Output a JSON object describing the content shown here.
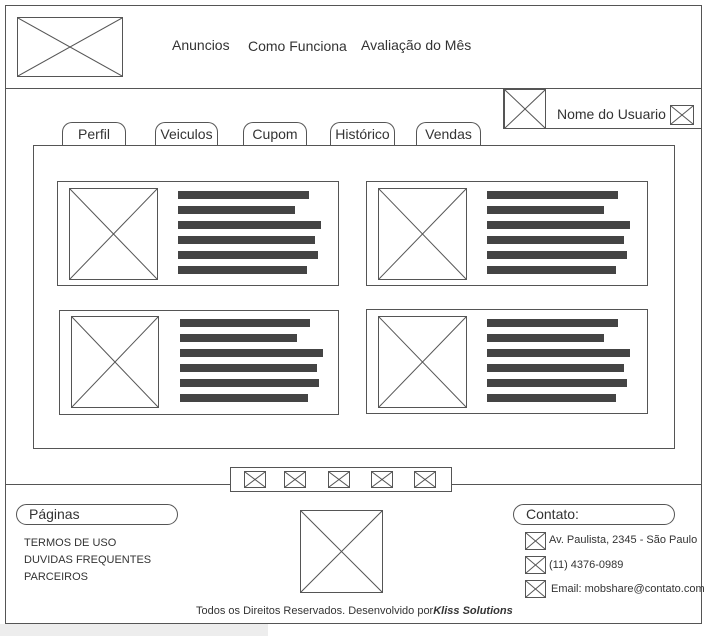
{
  "header": {
    "nav": [
      "Anuncios",
      "Como Funciona",
      "Avaliação do Mês"
    ]
  },
  "user": {
    "name": "Nome do Usuario"
  },
  "tabs": [
    "Perfil",
    "Veiculos",
    "Cupom",
    "Histórico",
    "Vendas"
  ],
  "footer": {
    "pages_title": "Páginas",
    "pages": [
      "TERMOS DE USO",
      "DUVIDAS FREQUENTES",
      "PARCEIROS"
    ],
    "contact_title": "Contato:",
    "address": "Av. Paulista, 2345 - São Paulo",
    "phone": "(11) 4376-0989",
    "email": "Email: mobshare@contato.com",
    "copyright": "Todos os Direitos Reservados. Desenvolvido por",
    "company": "Kliss Solutions"
  }
}
